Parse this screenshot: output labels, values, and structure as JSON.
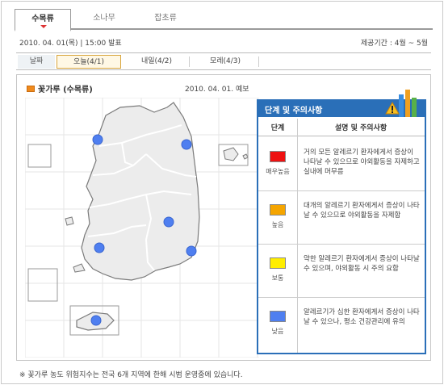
{
  "tabs": [
    {
      "label": "수목류",
      "active": true
    },
    {
      "label": "소나무",
      "active": false
    },
    {
      "label": "잡초류",
      "active": false
    }
  ],
  "announce": "2010. 04. 01(목) | 15:00 발표",
  "period": "제공기간 : 4월 ~ 5월",
  "datebar": {
    "label": "날짜",
    "days": [
      {
        "label": "오늘(4/1)",
        "selected": true
      },
      {
        "label": "내일(4/2)",
        "selected": false
      },
      {
        "label": "모레(4/3)",
        "selected": false
      }
    ]
  },
  "panel": {
    "title": "꽃가루 (수목류)",
    "forecast": "2010. 04. 01. 예보"
  },
  "legend": {
    "title": "단계 및 주의사항",
    "col_level": "단계",
    "col_desc": "설명 및 주의사항",
    "rows": [
      {
        "level": "매우높음",
        "color": "#ee1111",
        "desc": "거의 모든 알레르기 환자에게서 증상이 나타날 수 있으므로 야외활동을 자제하고 실내에 머무름"
      },
      {
        "level": "높음",
        "color": "#f5a500",
        "desc": "대개의 알레르기 환자에게서 증상이 나타날 수 있으므로 야외활동을 자제함"
      },
      {
        "level": "보통",
        "color": "#ffee00",
        "desc": "약한 알레르기 환자에게서 증상이 나타날 수 있으며, 야외활동 시 주의 요함"
      },
      {
        "level": "낮음",
        "color": "#4f7ff0",
        "desc": "알레르기가 심한 환자에게서 증상이 나타날 수 있으나, 평소 건강관리에 유의"
      }
    ]
  },
  "map": {
    "dot_color": "#4f7ff0",
    "dots": [
      {
        "region": "seoul-area",
        "level": "낮음"
      },
      {
        "region": "gangneung-area",
        "level": "낮음"
      },
      {
        "region": "daegu-area",
        "level": "낮음"
      },
      {
        "region": "busan-area",
        "level": "낮음"
      },
      {
        "region": "gwangju-area",
        "level": "낮음"
      },
      {
        "region": "jeju-area",
        "level": "낮음"
      }
    ]
  },
  "footnote": "※ 꽃가루 농도 위험지수는 전국 6개 지역에 한해 시범 운영중에 있습니다."
}
